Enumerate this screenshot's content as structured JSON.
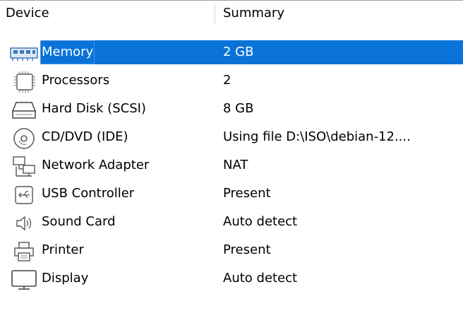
{
  "header": {
    "device": "Device",
    "summary": "Summary"
  },
  "devices": [
    {
      "name": "Memory",
      "summary": "2 GB",
      "icon": "memory-icon",
      "selected": true
    },
    {
      "name": "Processors",
      "summary": "2",
      "icon": "processor-icon"
    },
    {
      "name": "Hard Disk (SCSI)",
      "summary": "8 GB",
      "icon": "hard-disk-icon"
    },
    {
      "name": "CD/DVD (IDE)",
      "summary": "Using file D:\\ISO\\debian-12....",
      "icon": "cd-dvd-icon"
    },
    {
      "name": "Network Adapter",
      "summary": "NAT",
      "icon": "network-adapter-icon"
    },
    {
      "name": "USB Controller",
      "summary": "Present",
      "icon": "usb-icon"
    },
    {
      "name": "Sound Card",
      "summary": "Auto detect",
      "icon": "speaker-icon"
    },
    {
      "name": "Printer",
      "summary": "Present",
      "icon": "printer-icon"
    },
    {
      "name": "Display",
      "summary": "Auto detect",
      "icon": "monitor-icon"
    }
  ],
  "colors": {
    "selection": "#0a73d9",
    "selection_text": "#ffffff"
  }
}
